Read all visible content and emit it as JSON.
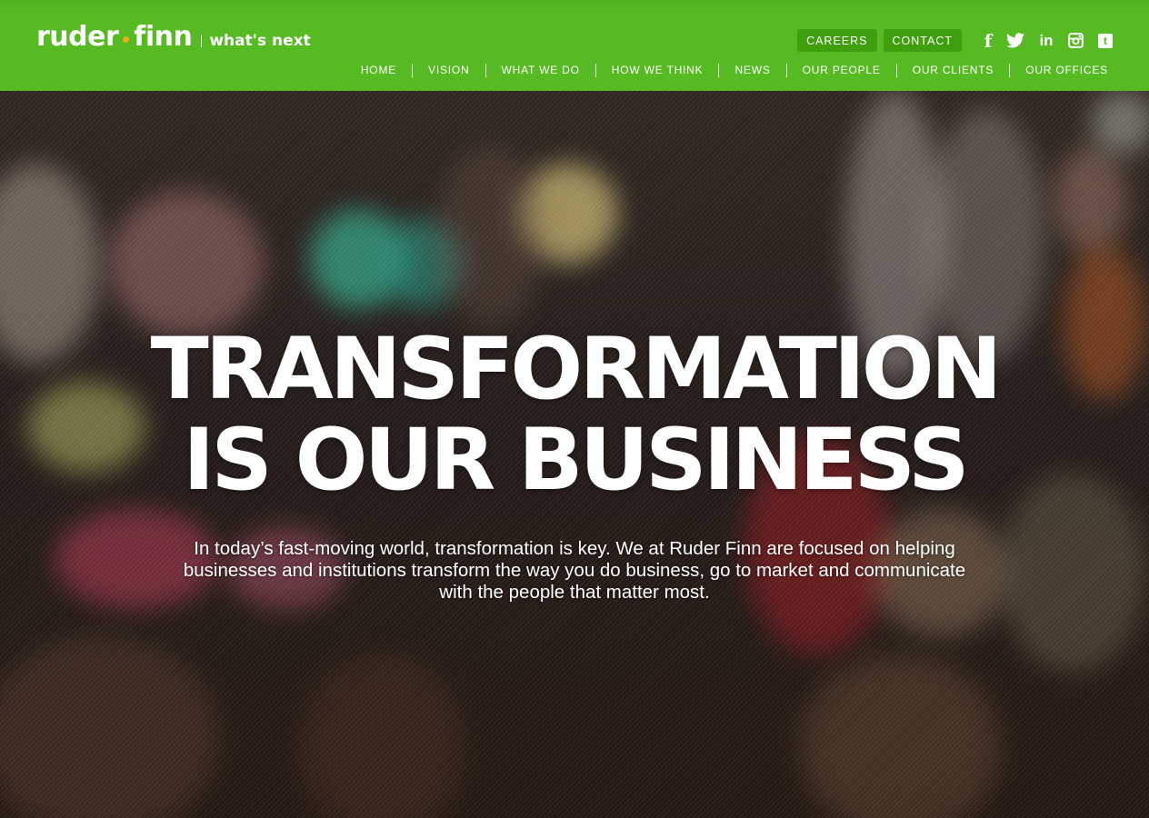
{
  "brand": {
    "name_part1": "ruder",
    "name_part2": "finn",
    "tagline": "what's next",
    "accent_color": "#56bb22",
    "dot_color": "#f6a623"
  },
  "utility": {
    "careers": "CAREERS",
    "contact": "CONTACT"
  },
  "social": [
    "facebook-icon",
    "twitter-icon",
    "linkedin-icon",
    "instagram-icon",
    "tumblr-icon"
  ],
  "nav": {
    "items": [
      "HOME",
      "VISION",
      "WHAT WE DO",
      "HOW WE THINK",
      "NEWS",
      "OUR PEOPLE",
      "OUR CLIENTS",
      "OUR OFFICES"
    ]
  },
  "hero": {
    "headline_line1": "TRANSFORMATION",
    "headline_line2": "IS OUR BUSINESS",
    "intro": "In today’s fast-moving world, transformation is key. We at Ruder Finn are focused on helping businesses and institutions transform the way you do business, go to market and communicate with the people that matter most."
  }
}
